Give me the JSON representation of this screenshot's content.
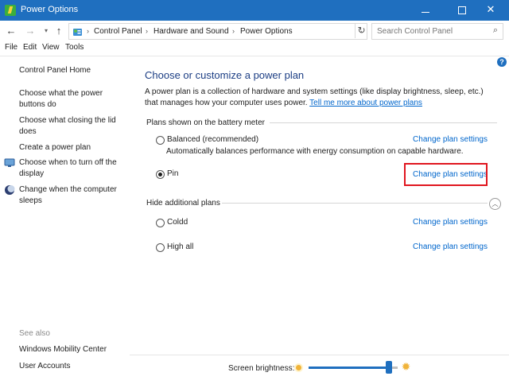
{
  "window": {
    "title": "Power Options",
    "minimize_glyph": "",
    "maximize_glyph": "",
    "close_glyph": "✕"
  },
  "address": {
    "breadcrumbs": [
      "Control Panel",
      "Hardware and Sound",
      "Power Options"
    ],
    "separator": "›",
    "search_placeholder": "Search Control Panel"
  },
  "menu": {
    "items": [
      "File",
      "Edit",
      "View",
      "Tools"
    ]
  },
  "sidebar": {
    "home": "Control Panel Home",
    "links": [
      "Choose what the power buttons do",
      "Choose what closing the lid does",
      "Create a power plan",
      "Choose when to turn off the display",
      "Change when the computer sleeps"
    ],
    "see_also_label": "See also",
    "see_also": [
      "Windows Mobility Center",
      "User Accounts"
    ]
  },
  "main": {
    "title": "Choose or customize a power plan",
    "description": "A power plan is a collection of hardware and system settings (like display brightness, sleep, etc.) that manages how your computer uses power.",
    "description_link": "Tell me more about power plans",
    "battery_group_label": "Plans shown on the battery meter",
    "hidden_group_label": "Hide additional plans",
    "change_link_label": "Change plan settings",
    "plans": [
      {
        "name": "Balanced (recommended)",
        "description": "Automatically balances performance with energy consumption on capable hardware.",
        "selected": false
      },
      {
        "name": "Pin",
        "description": "",
        "selected": true
      }
    ],
    "hidden_plans": [
      {
        "name": "Coldd",
        "selected": false
      },
      {
        "name": "High all",
        "selected": false
      }
    ]
  },
  "brightness": {
    "label": "Screen brightness:",
    "level_fraction": 0.9
  },
  "colors": {
    "titlebar": "#1f6fbf",
    "link": "#0066cc",
    "heading": "#1c3e84",
    "highlight": "#e0161f"
  }
}
